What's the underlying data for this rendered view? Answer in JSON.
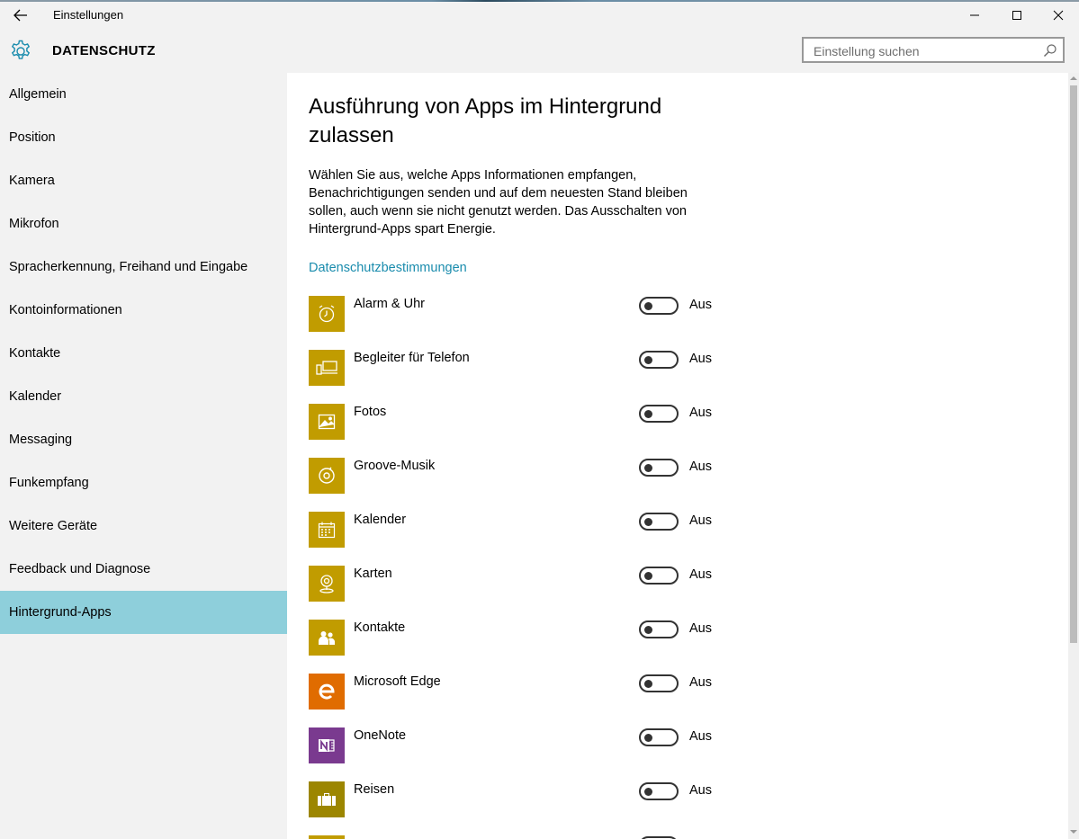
{
  "window": {
    "title": "Einstellungen"
  },
  "header": {
    "section_title": "DATENSCHUTZ",
    "search_placeholder": "Einstellung suchen"
  },
  "sidebar": {
    "items": [
      {
        "label": "Allgemein",
        "active": false
      },
      {
        "label": "Position",
        "active": false
      },
      {
        "label": "Kamera",
        "active": false
      },
      {
        "label": "Mikrofon",
        "active": false
      },
      {
        "label": "Spracherkennung, Freihand und Eingabe",
        "active": false
      },
      {
        "label": "Kontoinformationen",
        "active": false
      },
      {
        "label": "Kontakte",
        "active": false
      },
      {
        "label": "Kalender",
        "active": false
      },
      {
        "label": "Messaging",
        "active": false
      },
      {
        "label": "Funkempfang",
        "active": false
      },
      {
        "label": "Weitere Geräte",
        "active": false
      },
      {
        "label": "Feedback und Diagnose",
        "active": false
      },
      {
        "label": "Hintergrund-Apps",
        "active": true
      }
    ]
  },
  "main": {
    "title": "Ausführung von Apps im Hintergrund zulassen",
    "description": "Wählen Sie aus, welche Apps Informationen empfangen, Benachrichtigungen senden und auf dem neuesten Stand bleiben sollen, auch wenn sie nicht genutzt werden. Das Ausschalten von Hintergrund-Apps spart Energie.",
    "privacy_link": "Datenschutzbestimmungen",
    "apps": [
      {
        "name": "Alarm & Uhr",
        "icon": "alarm-clock-icon",
        "color": "#c19c00",
        "state": "Aus",
        "on": false
      },
      {
        "name": "Begleiter für Telefon",
        "icon": "phone-companion-icon",
        "color": "#c19c00",
        "state": "Aus",
        "on": false
      },
      {
        "name": "Fotos",
        "icon": "photos-icon",
        "color": "#c19c00",
        "state": "Aus",
        "on": false
      },
      {
        "name": "Groove-Musik",
        "icon": "groove-music-icon",
        "color": "#c19c00",
        "state": "Aus",
        "on": false
      },
      {
        "name": "Kalender",
        "icon": "calendar-icon",
        "color": "#c19c00",
        "state": "Aus",
        "on": false
      },
      {
        "name": "Karten",
        "icon": "maps-icon",
        "color": "#c19c00",
        "state": "Aus",
        "on": false
      },
      {
        "name": "Kontakte",
        "icon": "people-icon",
        "color": "#c19c00",
        "state": "Aus",
        "on": false
      },
      {
        "name": "Microsoft Edge",
        "icon": "edge-icon",
        "color": "#e06c00",
        "state": "Aus",
        "on": false
      },
      {
        "name": "OneNote",
        "icon": "onenote-icon",
        "color": "#7a3a8f",
        "state": "Aus",
        "on": false
      },
      {
        "name": "Reisen",
        "icon": "travel-icon",
        "color": "#9c8600",
        "state": "Aus",
        "on": false
      }
    ]
  }
}
